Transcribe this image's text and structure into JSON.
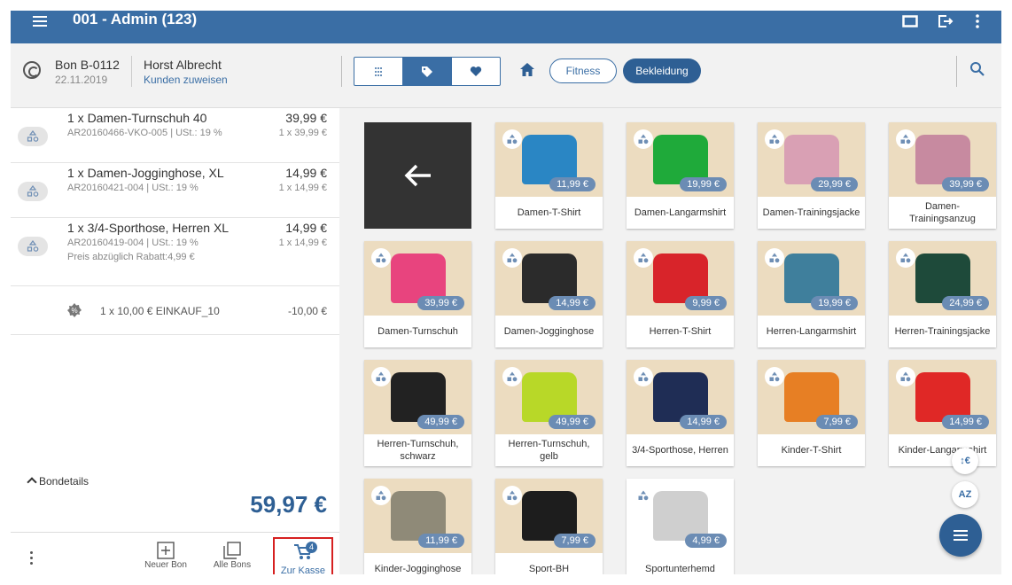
{
  "topbar": {
    "title": "001 - Admin (123)"
  },
  "header": {
    "bon_number": "Bon B-0112",
    "bon_date": "22.11.2019",
    "customer_name": "Horst Albrecht",
    "customer_link": "Kunden zuweisen",
    "filters": [
      {
        "label": "Fitness"
      },
      {
        "label": "Bekleidung"
      }
    ]
  },
  "cart": {
    "items": [
      {
        "name": "1 x Damen-Turnschuh 40",
        "sub": "AR20160466-VKO-005 | USt.: 19 %",
        "price": "39,99 €",
        "unit": "1 x 39,99 €"
      },
      {
        "name": "1 x Damen-Jogginghose, XL",
        "sub": "AR20160421-004 | USt.: 19 %",
        "price": "14,99 €",
        "unit": "1 x 14,99 €"
      },
      {
        "name": "1 x 3/4-Sporthose, Herren XL",
        "sub": "AR20160419-004 | USt.: 19 %",
        "note": "Preis abzüglich Rabatt:4,99 €",
        "price": "14,99 €",
        "unit": "1 x 14,99 €"
      }
    ],
    "discount": {
      "text": "1 x 10,00 € EINKAUF_10",
      "value": "-10,00 €"
    },
    "details_label": "Bondetails",
    "total": "59,97 €"
  },
  "bottom_bar": {
    "new_bon": "Neuer Bon",
    "all_bons": "Alle Bons",
    "checkout": "Zur Kasse",
    "checkout_count": "4"
  },
  "products": [
    {
      "name": "Damen-T-Shirt",
      "price": "11,99 €",
      "color": "#2a86c4"
    },
    {
      "name": "Damen-Langarmshirt",
      "price": "19,99 €",
      "color": "#1faa3a"
    },
    {
      "name": "Damen-Trainingsjacke",
      "price": "29,99 €",
      "color": "#d9a0b4"
    },
    {
      "name": "Damen-Trainingsanzug",
      "price": "39,99 €",
      "color": "#c78aa0"
    },
    {
      "name": "Damen-Turnschuh",
      "price": "39,99 €",
      "color": "#e8447e"
    },
    {
      "name": "Damen-Jogginghose",
      "price": "14,99 €",
      "color": "#2b2b2b"
    },
    {
      "name": "Herren-T-Shirt",
      "price": "9,99 €",
      "color": "#d8242a"
    },
    {
      "name": "Herren-Langarmshirt",
      "price": "19,99 €",
      "color": "#3f7f9c"
    },
    {
      "name": "Herren-Trainingsjacke",
      "price": "24,99 €",
      "color": "#1e4a3a"
    },
    {
      "name": "Herren-Turnschuh, schwarz",
      "price": "49,99 €",
      "color": "#222222"
    },
    {
      "name": "Herren-Turnschuh, gelb",
      "price": "49,99 €",
      "color": "#b8d828"
    },
    {
      "name": "3/4-Sporthose, Herren",
      "price": "14,99 €",
      "color": "#1f2d55"
    },
    {
      "name": "Kinder-T-Shirt",
      "price": "7,99 €",
      "color": "#e77f24"
    },
    {
      "name": "Kinder-Langarmshirt",
      "price": "14,99 €",
      "color": "#e02826"
    },
    {
      "name": "Kinder-Jogginghose",
      "price": "11,99 €",
      "color": "#8f8a78"
    },
    {
      "name": "Sport-BH",
      "price": "7,99 €",
      "color": "#1d1d1d"
    },
    {
      "name": "Sportunterhemd",
      "price": "4,99 €",
      "color": "#cfcfcf"
    }
  ],
  "sort_buttons": {
    "price_sort": "↕€",
    "alpha_sort": "AZ"
  }
}
